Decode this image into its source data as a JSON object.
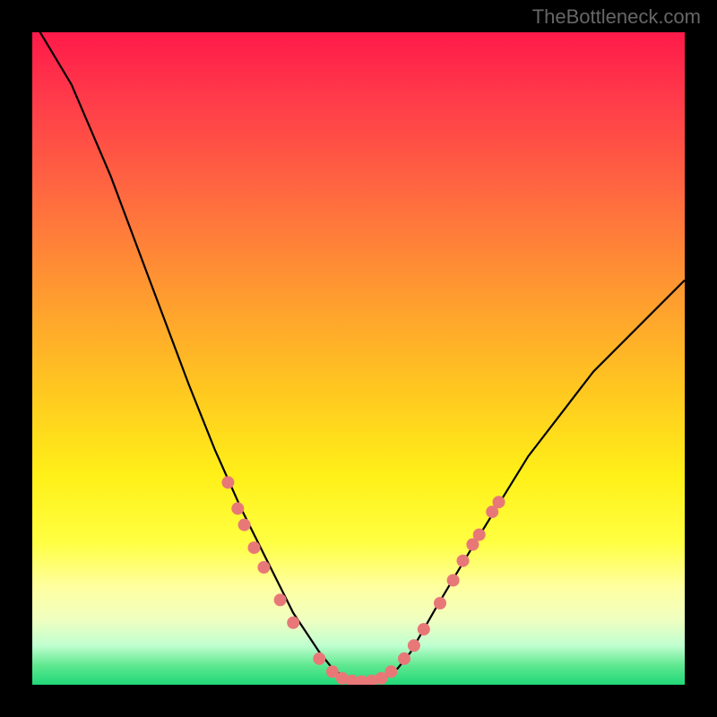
{
  "watermark": "TheBottleneck.com",
  "chart_data": {
    "type": "line",
    "title": "",
    "xlabel": "",
    "ylabel": "",
    "xlim": [
      0,
      100
    ],
    "ylim": [
      0,
      100
    ],
    "curve": {
      "x": [
        0,
        6,
        12,
        18,
        24,
        28,
        32,
        36,
        40,
        44,
        46,
        48,
        50,
        52,
        54,
        56,
        58,
        62,
        68,
        76,
        86,
        100
      ],
      "y": [
        102,
        92,
        78,
        62,
        46,
        36,
        27,
        19,
        11,
        5,
        2.5,
        1,
        0.5,
        0.5,
        1,
        2.5,
        5,
        12,
        22,
        35,
        48,
        62
      ]
    },
    "scatter_points": [
      {
        "x": 30.0,
        "y": 31.0
      },
      {
        "x": 31.5,
        "y": 27.0
      },
      {
        "x": 32.5,
        "y": 24.5
      },
      {
        "x": 34.0,
        "y": 21.0
      },
      {
        "x": 35.5,
        "y": 18.0
      },
      {
        "x": 38.0,
        "y": 13.0
      },
      {
        "x": 40.0,
        "y": 9.5
      },
      {
        "x": 44.0,
        "y": 4.0
      },
      {
        "x": 46.0,
        "y": 2.0
      },
      {
        "x": 47.5,
        "y": 1.0
      },
      {
        "x": 49.0,
        "y": 0.6
      },
      {
        "x": 50.5,
        "y": 0.5
      },
      {
        "x": 52.0,
        "y": 0.6
      },
      {
        "x": 53.5,
        "y": 1.0
      },
      {
        "x": 55.0,
        "y": 2.0
      },
      {
        "x": 57.0,
        "y": 4.0
      },
      {
        "x": 58.5,
        "y": 6.0
      },
      {
        "x": 60.0,
        "y": 8.5
      },
      {
        "x": 62.5,
        "y": 12.5
      },
      {
        "x": 64.5,
        "y": 16.0
      },
      {
        "x": 66.0,
        "y": 19.0
      },
      {
        "x": 67.5,
        "y": 21.5
      },
      {
        "x": 68.5,
        "y": 23.0
      },
      {
        "x": 70.5,
        "y": 26.5
      },
      {
        "x": 71.5,
        "y": 28.0
      }
    ]
  }
}
